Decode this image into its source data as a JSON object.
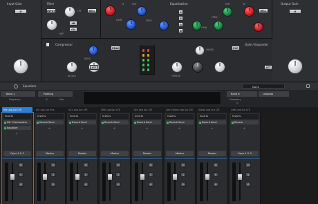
{
  "top": {
    "input_gain": {
      "title": "Input Gain",
      "button": "Ø"
    },
    "filter": {
      "title": "Filter",
      "input_btn": "INPUT",
      "db_btn": "dB",
      "on_btn": "ON",
      "labels": [
        "LPF",
        "HPF",
        "12k",
        "50Hz"
      ]
    },
    "equalisation": {
      "title": "Equalisation",
      "bell_btn": "BELL",
      "labels": [
        "LF",
        "LMF",
        "HMF",
        "HF",
        "GAIN",
        "FREQ",
        "Q",
        "GAIN",
        "FREQ",
        "GAIN",
        "FREQ",
        "GAIN",
        "FREQ",
        "Q"
      ],
      "side_btns": [
        "4",
        "E",
        "A",
        "B"
      ]
    },
    "output_gain": {
      "title": "Output Gain",
      "button": "Ø"
    },
    "compressor": {
      "title": "Compressor",
      "peak_btn": "PEAK",
      "att_btn": "ATT",
      "labels": [
        "RATIO",
        "ATTACK",
        "RELEASE",
        "THRESH",
        "GAIN"
      ]
    },
    "gate": {
      "title": "Gate / Expander",
      "exp_btn": "EXP",
      "att_btn": "ATT",
      "labels": [
        "RANGE",
        "THRESH",
        "RELEASE",
        "HOLD",
        "ATTACK"
      ]
    }
  },
  "eq_bar": {
    "title": "Equalizer",
    "preset": "None",
    "band1": "Band 1",
    "band1_type": "Peaking",
    "band1_freq": "Frequency",
    "band1_q": "Q",
    "band1_gain": "Gain",
    "band8": "Band 8",
    "band8_type": "Lowpass",
    "band8_freq": "Frequency",
    "band8_q": "Q"
  },
  "channels": [
    {
      "name": "Vla Leg Sur LFE",
      "inserts": "Inserts",
      "slots": [
        "SSL Channelstrip",
        "Equalizer"
      ],
      "route": "Opus 1 & 2",
      "selected": true
    },
    {
      "name": "Vln Leg Sur Ens",
      "inserts": "Inserts",
      "slots": [
        "Reverb Send"
      ],
      "route": "Master",
      "selected": false
    },
    {
      "name": "VCL Leg Sur LFE",
      "inserts": "Inserts",
      "slots": [
        "Reverb Send"
      ],
      "route": "Master",
      "selected": false
    },
    {
      "name": "VBS Leg Sur LFE",
      "inserts": "Inserts",
      "slots": [
        "Reverb Send"
      ],
      "route": "Master",
      "selected": false
    },
    {
      "name": "1Vn Leg Sur LTE",
      "inserts": "Inserts",
      "slots": [
        "Reverb Send"
      ],
      "route": "Master",
      "selected": false
    },
    {
      "name": "2nd Violins Leg Sur LTE",
      "inserts": "Inserts",
      "slots": [
        "Reverb Send"
      ],
      "route": "Master",
      "selected": false
    },
    {
      "name": "Violas Leg Sur LTE",
      "inserts": "Inserts",
      "slots": [
        "Reverb Send"
      ],
      "route": "Master",
      "selected": false
    },
    {
      "name": "Celli Leg Sur LTE",
      "inserts": "Inserts",
      "slots": [
        "Reverb"
      ],
      "route": "Opus 1 & 2",
      "selected": false
    }
  ],
  "strip_buttons": [
    "M",
    "S",
    "Ø"
  ]
}
